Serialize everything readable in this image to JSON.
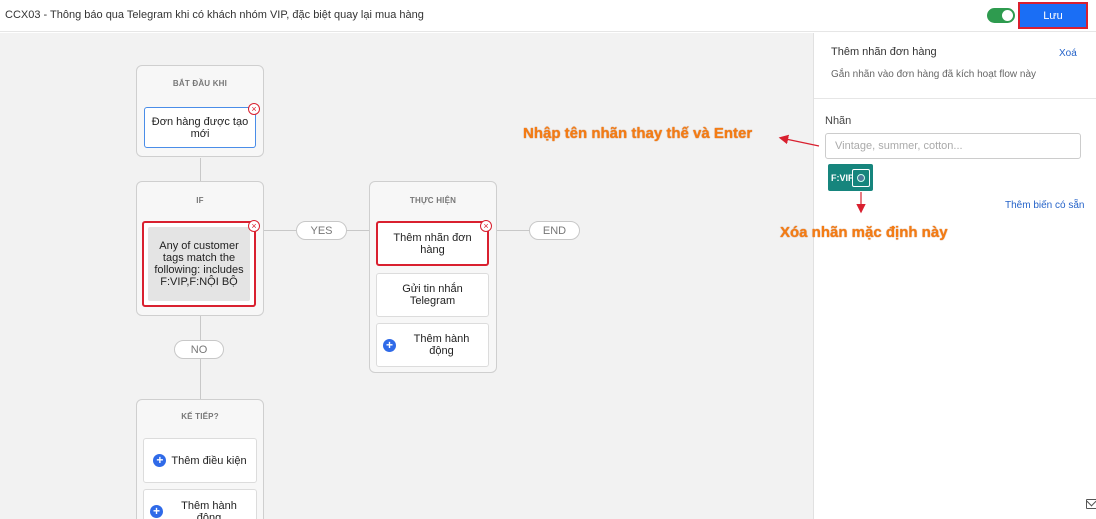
{
  "header": {
    "flow_title": "CCX03 - Thông báo qua Telegram khi có khách nhóm VIP, đặc biệt quay lại mua hàng",
    "save_label": "Lưu"
  },
  "canvas": {
    "start": {
      "heading": "BẮT ĐẦU KHI",
      "trigger": "Đơn hàng được tạo mới"
    },
    "condition": {
      "heading": "IF",
      "text": "Any of customer tags match the following: includes F:VIP,F:NỘI BỘ"
    },
    "branch_yes": "YES",
    "branch_no": "NO",
    "end_label": "END",
    "actions": {
      "heading": "THỰC HIỆN",
      "items": [
        "Thêm nhãn đơn hàng",
        "Gửi tin nhắn Telegram"
      ],
      "add_action": "Thêm hành động"
    },
    "next": {
      "heading": "KẾ TIẾP?",
      "add_condition": "Thêm điều kiện",
      "add_action": "Thêm hành động"
    }
  },
  "panel": {
    "title": "Thêm nhãn đơn hàng",
    "delete_label": "Xoá",
    "description": "Gắn nhãn vào đơn hàng đã kích hoạt flow này",
    "label_caption": "Nhãn",
    "label_placeholder": "Vintage, summer, cotton...",
    "tag": "F:VIP",
    "insert_variable": "Thêm biến có sẵn"
  },
  "annotations": {
    "enter_label": "Nhập tên nhãn thay thế và Enter",
    "remove_label": "Xóa nhãn mặc định này"
  },
  "colors": {
    "accent": "#1a6ef5",
    "highlight": "#d9202f",
    "tag": "#16857d",
    "annotation": "#f57c13",
    "toggle_on": "#2e9b4f"
  }
}
